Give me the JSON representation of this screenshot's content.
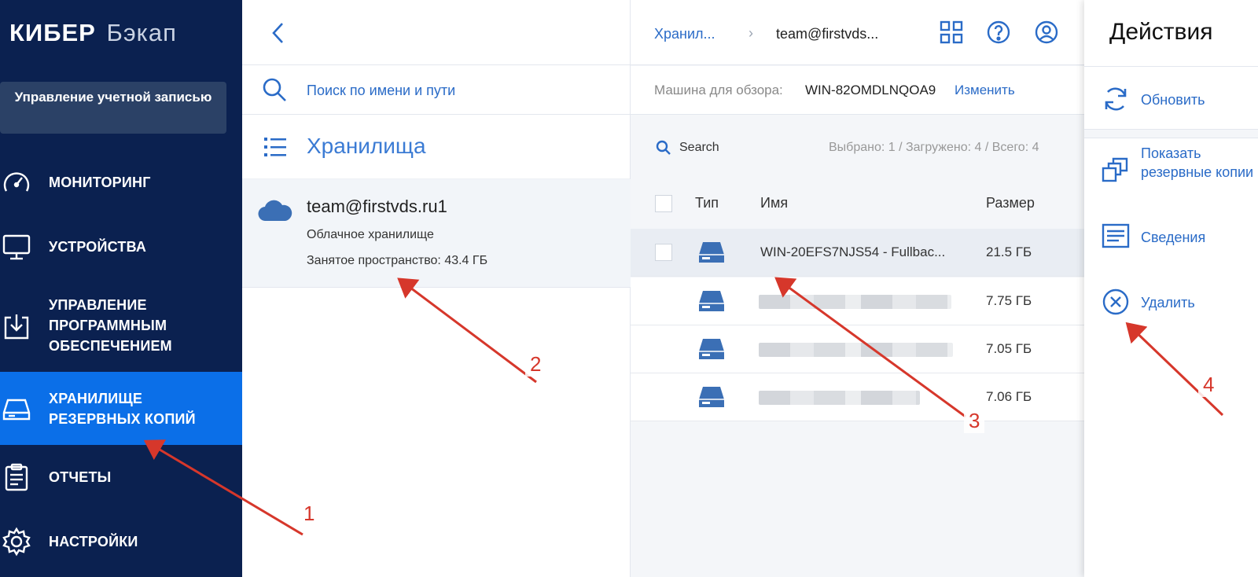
{
  "sidebar": {
    "logo_strong": "КИБЕР",
    "logo_light": "Бэкап",
    "account_button": "Управление учетной записью",
    "items": [
      {
        "label": "МОНИТОРИНГ",
        "icon": "speedometer-icon"
      },
      {
        "label": "УСТРОЙСТВА",
        "icon": "monitor-icon"
      },
      {
        "label": "УПРАВЛЕНИЕ ПРОГРАММНЫМ ОБЕСПЕЧЕНИЕМ",
        "icon": "software-download-icon"
      },
      {
        "label": "ХРАНИЛИЩЕ РЕЗЕРВНЫХ КОПИЙ",
        "icon": "storage-drive-icon",
        "active": true
      },
      {
        "label": "ОТЧЕТЫ",
        "icon": "report-clipboard-icon"
      },
      {
        "label": "НАСТРОЙКИ",
        "icon": "gear-icon"
      }
    ]
  },
  "middle": {
    "search_placeholder": "Поиск по имени и пути",
    "title": "Хранилища",
    "storage": {
      "name": "team@firstvds.ru1",
      "type": "Облачное хранилище",
      "space": "Занятое пространство: 43.4 ГБ"
    }
  },
  "main": {
    "breadcrumb": [
      "Хранил...",
      "team@firstvds..."
    ],
    "breadcrumb_sep": "›",
    "machine_label": "Машина для обзора:",
    "machine_value": "WIN-82OMDLNQOA9",
    "change_link": "Изменить",
    "search_label": "Search",
    "counts": "Выбрано: 1 / Загружено: 4 / Всего: 4",
    "columns": [
      "Тип",
      "Имя",
      "Размер"
    ],
    "rows": [
      {
        "name": "WIN-20EFS7NJS54 - Fullbac...",
        "size": "21.5 ГБ",
        "selected": true
      },
      {
        "name": "",
        "size": "7.75 ГБ",
        "blurred": true
      },
      {
        "name": "",
        "size": "7.05 ГБ",
        "blurred": true
      },
      {
        "name": "",
        "size": "7.06 ГБ",
        "blurred": true
      }
    ]
  },
  "actions": {
    "title": "Действия",
    "items": [
      {
        "label": "Обновить",
        "icon": "refresh-icon"
      },
      {
        "label": "Показать резервные копии",
        "icon": "copies-icon"
      },
      {
        "label": "Сведения",
        "icon": "details-icon"
      },
      {
        "label": "Удалить",
        "icon": "delete-circle-icon"
      }
    ]
  },
  "annotations": [
    "1",
    "2",
    "3",
    "4"
  ],
  "colors": {
    "sidebar_bg": "#0b2150",
    "active_bg": "#0b6fe8",
    "accent": "#2a6bc7",
    "arrow": "#d6372b"
  }
}
